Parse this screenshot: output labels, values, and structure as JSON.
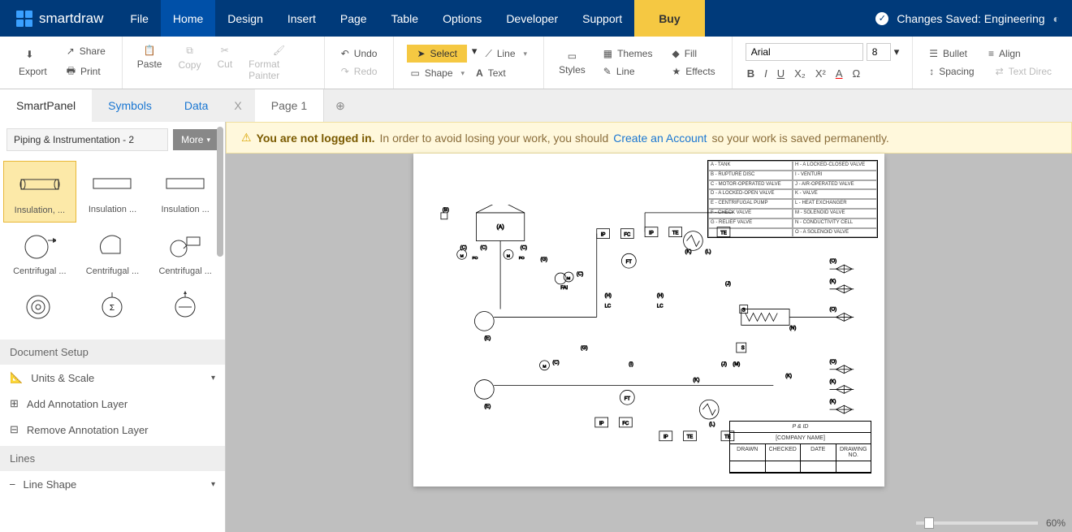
{
  "app": {
    "name": "smartdraw"
  },
  "menu": {
    "items": [
      "File",
      "Home",
      "Design",
      "Insert",
      "Page",
      "Table",
      "Options",
      "Developer",
      "Support"
    ],
    "active": "Home",
    "buy": "Buy",
    "status": "Changes Saved: Engineering"
  },
  "ribbon": {
    "export": "Export",
    "share": "Share",
    "print": "Print",
    "paste": "Paste",
    "copy": "Copy",
    "cut": "Cut",
    "format_painter": "Format Painter",
    "undo": "Undo",
    "redo": "Redo",
    "select": "Select",
    "shape": "Shape",
    "line": "Line",
    "text": "Text",
    "styles": "Styles",
    "themes": "Themes",
    "fill": "Fill",
    "line2": "Line",
    "effects": "Effects",
    "font_name": "Arial",
    "font_size": "8",
    "bullet": "Bullet",
    "align": "Align",
    "spacing": "Spacing",
    "text_dir": "Text Direc"
  },
  "tabs": {
    "smartpanel": "SmartPanel",
    "symbols": "Symbols",
    "data": "Data",
    "close": "X",
    "page": "Page 1"
  },
  "warning": {
    "prefix": "You are not logged in.",
    "mid": "In order to avoid losing your work, you should",
    "link": "Create an Account",
    "suffix": "so your work is saved permanently."
  },
  "library": {
    "title": "Piping & Instrumentation - 2",
    "more": "More",
    "symbols": [
      {
        "label": "Insulation, ...",
        "selected": true
      },
      {
        "label": "Insulation ..."
      },
      {
        "label": "Insulation ..."
      },
      {
        "label": "Centrifugal ..."
      },
      {
        "label": "Centrifugal ..."
      },
      {
        "label": "Centrifugal ..."
      },
      {
        "label": ""
      },
      {
        "label": ""
      },
      {
        "label": ""
      }
    ]
  },
  "sections": {
    "doc_setup": "Document Setup",
    "units": "Units & Scale",
    "add_layer": "Add Annotation Layer",
    "remove_layer": "Remove Annotation Layer",
    "lines": "Lines",
    "line_shape": "Line Shape"
  },
  "legend": [
    [
      "A - TANK",
      "H - A LOCKED-CLOSED VALVE"
    ],
    [
      "B - RUPTURE DISC",
      "I - VENTURI"
    ],
    [
      "C - MOTOR-OPERATED VALVE",
      "J - AIR-OPERATED VALVE"
    ],
    [
      "D - A LOCKED-OPEN VALVE",
      "K - VALVE"
    ],
    [
      "E - CENTRIFUGAL PUMP",
      "L - HEAT EXCHANGER"
    ],
    [
      "F - CHECK VALVE",
      "M - SOLENOID VALVE"
    ],
    [
      "G - RELIEF VALVE",
      "N - CONDUCTIVITY CELL"
    ],
    [
      "",
      "O - A SOLENOID VALVE"
    ]
  ],
  "title_block": {
    "title": "P & ID",
    "company": "[COMPANY NAME]",
    "cols": [
      "DRAWN",
      "CHECKED",
      "DATE",
      "DRAWING NO."
    ]
  },
  "zoom": {
    "value": "60%"
  }
}
